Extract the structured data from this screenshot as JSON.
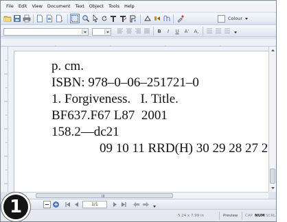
{
  "menu": [
    "File",
    "Edit",
    "View",
    "Document",
    "Text",
    "Object",
    "Tools",
    "Help"
  ],
  "toolbar": {
    "colour_label": "Colour",
    "bold": "B",
    "italic": "I",
    "underline": "U",
    "superscript": "A'",
    "subscript": "A,"
  },
  "document": {
    "lines": [
      "p. cm.",
      "ISBN: 978–0–06–251721–0",
      "1. Forgiveness.   I. Title.",
      "BF637.F67 L87  2001",
      "158.2—dc21",
      "09 10 11 RRD(H) 30 29 28 27 2"
    ]
  },
  "hscroll": {
    "grip": "III"
  },
  "navigation": {
    "page_field": "1/1"
  },
  "status": {
    "page_size": "5.24 x 7.99 in",
    "mode": "Preview",
    "cap": "CAP",
    "num": "NUM",
    "scrl": "SCRL"
  },
  "step_badge": "1"
}
